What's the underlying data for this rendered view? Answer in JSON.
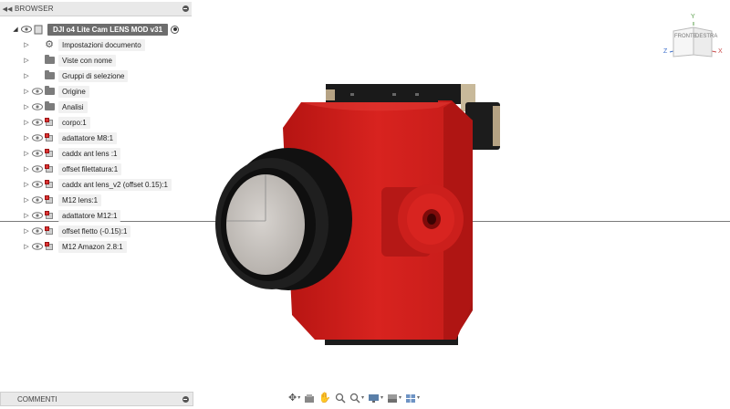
{
  "browser": {
    "title": "BROWSER",
    "root": {
      "label": "DJI o4 Lite Cam LENS MOD v31"
    },
    "items": [
      {
        "label": "Impostazioni documento",
        "icon": "gear-icon",
        "eye": false
      },
      {
        "label": "Viste con nome",
        "icon": "folder-icon",
        "eye": false
      },
      {
        "label": "Gruppi di selezione",
        "icon": "folder-icon",
        "eye": false
      },
      {
        "label": "Origine",
        "icon": "folder-icon",
        "eye": true
      },
      {
        "label": "Analisi",
        "icon": "folder-icon",
        "eye": true
      },
      {
        "label": "corpo:1",
        "icon": "component-icon",
        "eye": true
      },
      {
        "label": "adattatore M8:1",
        "icon": "component-icon",
        "eye": true
      },
      {
        "label": "caddx ant lens :1",
        "icon": "component-icon",
        "eye": true
      },
      {
        "label": "offset filettatura:1",
        "icon": "component-icon",
        "eye": true
      },
      {
        "label": "caddx ant lens_v2 (offset 0.15):1",
        "icon": "component-icon",
        "eye": true
      },
      {
        "label": "M12 lens:1",
        "icon": "component-icon",
        "eye": true
      },
      {
        "label": "adattatore M12:1",
        "icon": "component-icon",
        "eye": true
      },
      {
        "label": "offset fletto (-0.15):1",
        "icon": "component-icon",
        "eye": true
      },
      {
        "label": "M12 Amazon 2.8:1",
        "icon": "component-icon",
        "eye": true
      }
    ]
  },
  "comments": {
    "title": "COMMENTI"
  },
  "viewcube": {
    "front": "FRONTE",
    "right": "DESTRA",
    "axis_y": "Y",
    "axis_z": "Z",
    "axis_x": "X"
  },
  "toolbar": {
    "items": [
      "orbit-icon",
      "look-at-icon",
      "pan-icon",
      "zoom-icon",
      "zoom-window-icon",
      "display-settings-icon",
      "visual-style-icon",
      "grid-icon"
    ]
  },
  "colors": {
    "model_red": "#d0201f",
    "lens_black": "#1b1b1b",
    "lens_glass": "#c9c6c2",
    "accent_bronze": "#b5a283"
  }
}
